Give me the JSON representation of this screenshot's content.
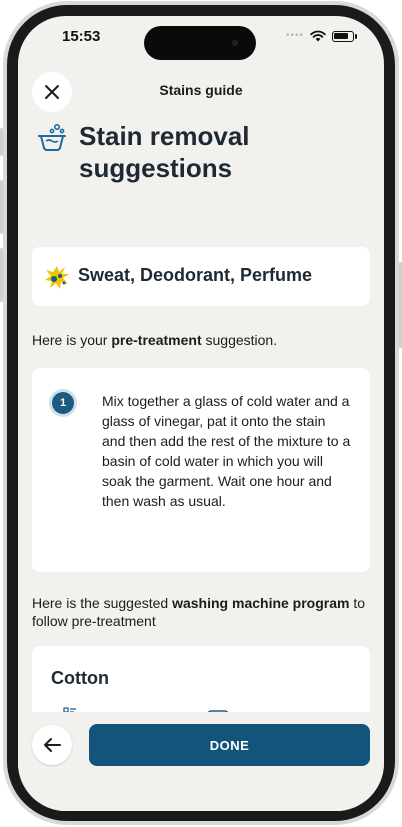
{
  "status_bar": {
    "time": "15:53"
  },
  "header": {
    "title": "Stains guide",
    "close_icon": "close-icon"
  },
  "page": {
    "title": "Stain removal suggestions",
    "icon": "basin-icon"
  },
  "stain": {
    "label": "Sweat, Deodorant, Perfume",
    "icon": "splash-icon",
    "icon_color": "#f2c300"
  },
  "pretreatment_intro": {
    "prefix": "Here is your ",
    "emphasis": "pre-treatment",
    "suffix": " suggestion."
  },
  "steps": [
    {
      "number": "1",
      "text": "Mix together a glass of cold water and a glass of vinegar, pat it onto the stain and then add the rest of the mixture to a basin of cold water in which you will soak the garment. Wait one hour and then wash as usual."
    }
  ],
  "program_intro": {
    "prefix": "Here is the suggested ",
    "emphasis": "washing machine program",
    "suffix": " to follow pre-treatment"
  },
  "program": {
    "name": "Cotton"
  },
  "footer": {
    "done_label": "DONE",
    "back_icon": "arrow-left-icon"
  },
  "colors": {
    "accent": "#13557a",
    "background": "#f2f1ee",
    "card": "#ffffff"
  }
}
